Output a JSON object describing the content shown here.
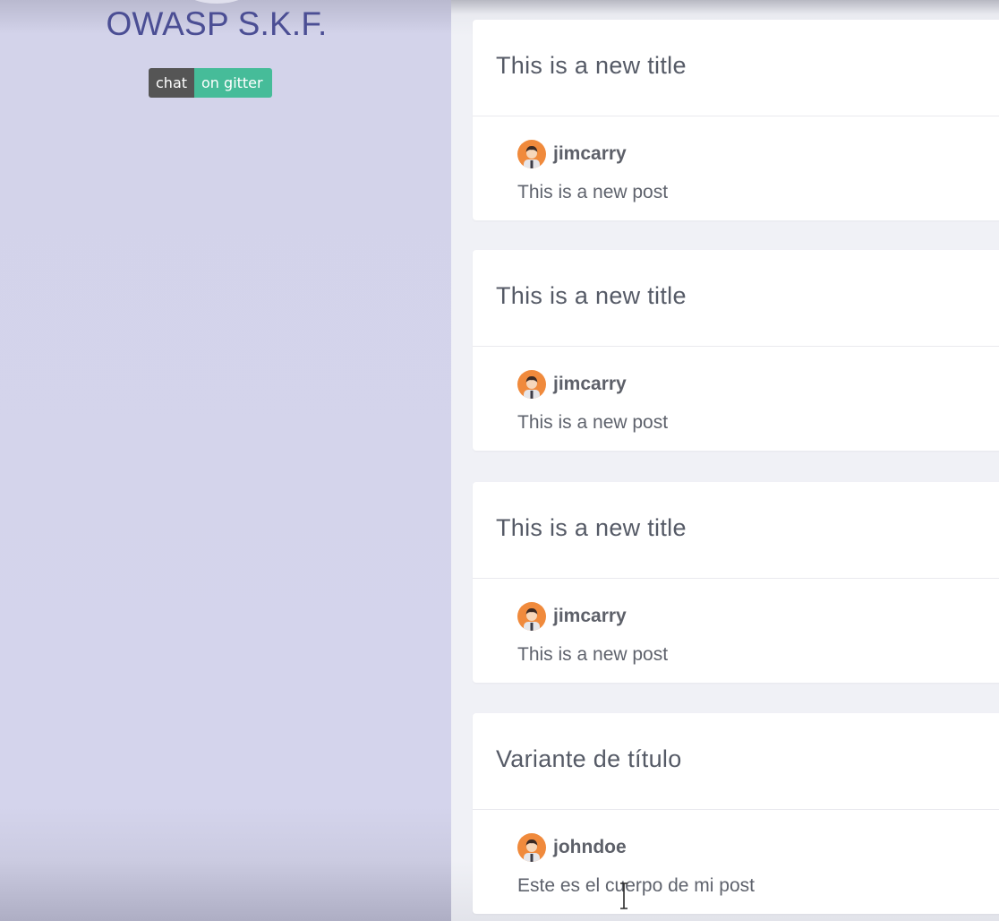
{
  "sidebar": {
    "brand": "OWASP S.K.F.",
    "badge": {
      "left": "chat",
      "right": "on gitter"
    }
  },
  "posts": [
    {
      "title": "This is a new title",
      "author": "jimcarry",
      "body": "This is a new post"
    },
    {
      "title": "This is a new title",
      "author": "jimcarry",
      "body": "This is a new post"
    },
    {
      "title": "This is a new title",
      "author": "jimcarry",
      "body": "This is a new post"
    },
    {
      "title": "Variante de título",
      "author": "johndoe",
      "body": "Este es el cuerpo de mi post"
    }
  ],
  "colors": {
    "sidebar_bg": "#d4d4ec",
    "brand_text": "#4b4e94",
    "badge_left": "#555555",
    "badge_right": "#46bc99",
    "avatar": "#f08a3c"
  },
  "icons": {
    "avatar": "user-avatar-icon",
    "cursor": "text-cursor-icon"
  }
}
